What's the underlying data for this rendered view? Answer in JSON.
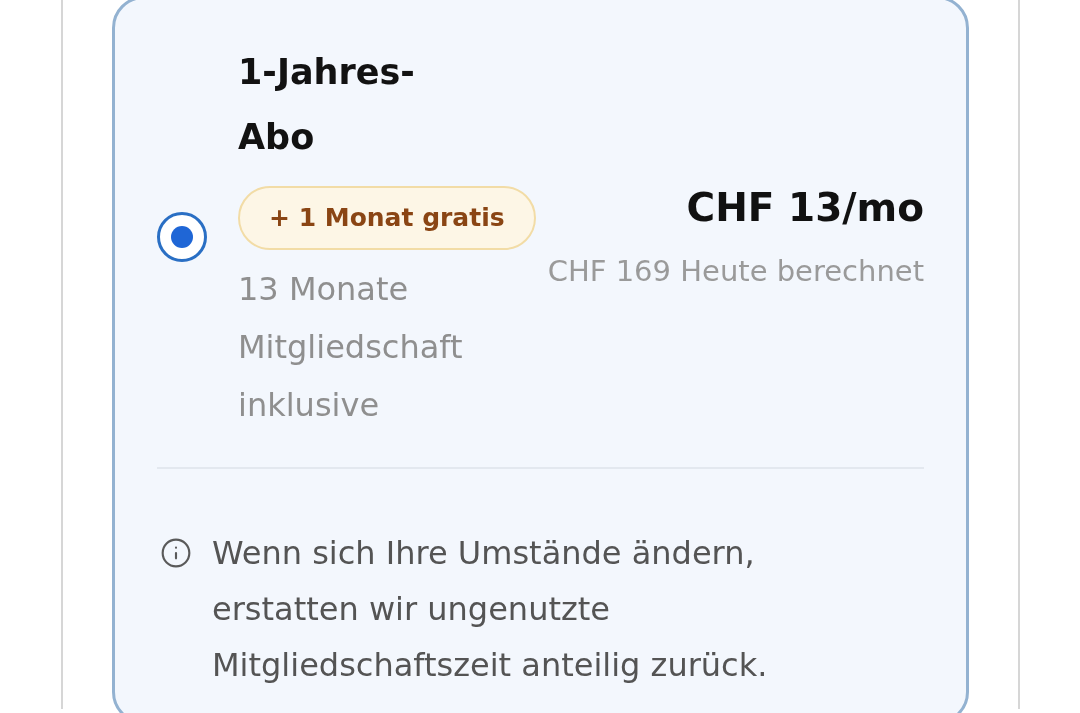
{
  "plan": {
    "selected": true,
    "title": "1-Jahres-Abo",
    "badge": "+ 1 Monat gratis",
    "description": "13 Monate Mitgliedschaft inklusive",
    "price": "CHF 13/mo",
    "billing_note": "CHF 169 Heute berechnet"
  },
  "notice": {
    "text": "Wenn sich Ihre Umstände ändern, erstatten wir ungenutzte Mitgliedschaftszeit anteilig zurück."
  }
}
